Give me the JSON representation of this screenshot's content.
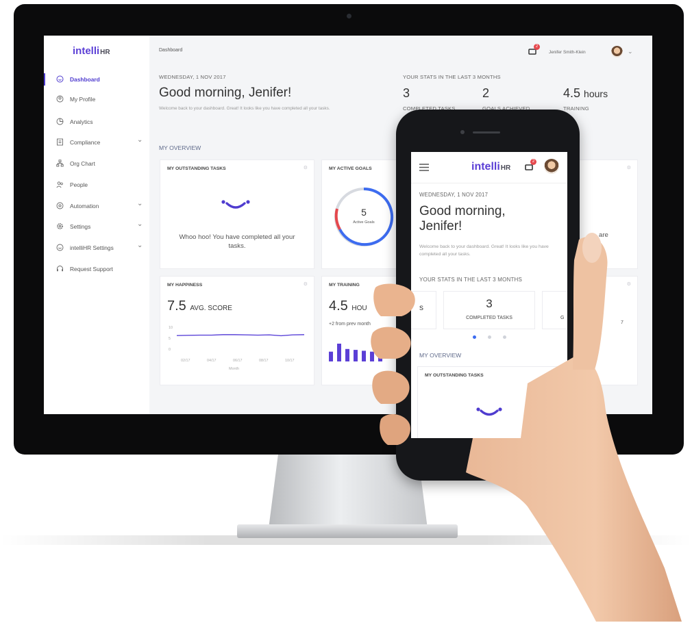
{
  "desktop": {
    "logo": {
      "main": "intelli",
      "suffix": "HR"
    },
    "sidebar": {
      "items": [
        {
          "label": "Dashboard",
          "icon": "dashboard-icon",
          "active": true
        },
        {
          "label": "My Profile",
          "icon": "profile-icon"
        },
        {
          "label": "Analytics",
          "icon": "analytics-icon"
        },
        {
          "label": "Compliance",
          "icon": "compliance-icon",
          "chevron": "⌄"
        },
        {
          "label": "Org Chart",
          "icon": "org-chart-icon"
        },
        {
          "label": "People",
          "icon": "people-icon"
        },
        {
          "label": "Automation",
          "icon": "automation-icon",
          "chevron": "⌄"
        },
        {
          "label": "Settings",
          "icon": "settings-icon",
          "chevron": "⌄"
        },
        {
          "label": "intelliHR Settings",
          "icon": "intellihr-settings-icon",
          "chevron": "⌄"
        },
        {
          "label": "Request Support",
          "icon": "support-icon"
        }
      ]
    },
    "header": {
      "breadcrumb": "Dashboard",
      "notification_count": "2",
      "user_name": "Jenifer Smith-Klein",
      "user_chevron": "⌄"
    },
    "main": {
      "date": "WEDNESDAY, 1 NOV 2017",
      "greeting": "Good morning, Jenifer!",
      "welcome": "Welcome back to your dashboard. Great! It looks like you have completed all your tasks.",
      "stats_title": "YOUR STATS IN THE LAST 3 MONTHS",
      "stats": [
        {
          "value": "3",
          "label": "COMPLETED TASKS"
        },
        {
          "value": "2",
          "label": "GOALS ACHIEVED"
        },
        {
          "value": "4.5",
          "unit": "hours",
          "label": "TRAINING"
        }
      ],
      "overview_title": "MY OVERVIEW",
      "cards": {
        "tasks": {
          "title": "MY OUTSTANDING TASKS",
          "message": "Whoo hoo! You have completed all your tasks."
        },
        "goals": {
          "title": "MY ACTIVE GOALS",
          "count": "5",
          "count_label": "Active Goals"
        },
        "partial_right": {
          "text": "are"
        },
        "happiness": {
          "title": "MY HAPPINESS",
          "score": "7.5",
          "score_label": "AVG. SCORE",
          "y_ticks": [
            "10",
            "5",
            "0"
          ],
          "x_ticks": [
            "02/17",
            "04/17",
            "06/17",
            "08/17",
            "10/17"
          ],
          "x_label": "Month",
          "series": [
            6.2,
            6.3,
            6.4,
            6.4,
            6.6,
            6.6,
            6.5,
            6.4,
            6.5,
            6.1,
            6.5,
            6.6
          ]
        },
        "training": {
          "title": "MY TRAINING",
          "value": "4.5",
          "unit": "HOU",
          "delta": "+2 from prev month",
          "bars": [
            0.55,
            1.0,
            0.7,
            0.65,
            0.6,
            0.55,
            0.5
          ]
        },
        "partial_right2": {
          "text": "7"
        }
      }
    }
  },
  "phone": {
    "logo": {
      "main": "intelli",
      "suffix": "HR"
    },
    "notification_count": "2",
    "date": "WEDNESDAY, 1 NOV 2017",
    "greeting_line1": "Good morning,",
    "greeting_line2": "Jenifer!",
    "welcome": "Welcome back to your dashboard. Great! It looks like you have completed all your tasks.",
    "stats_title": "YOUR STATS IN THE LAST 3 MONTHS",
    "stat_left_partial": "s",
    "stat": {
      "value": "3",
      "label": "COMPLETED TASKS"
    },
    "stat_right_partial": "G",
    "overview_title": "MY OVERVIEW",
    "card_title": "MY OUTSTANDING TASKS"
  },
  "colors": {
    "brand": "#5b3fd6",
    "goal_blue": "#3d6cf0",
    "goal_red": "#e5484d",
    "chart_line": "#5b44d8",
    "notif_red": "#e5484d"
  }
}
